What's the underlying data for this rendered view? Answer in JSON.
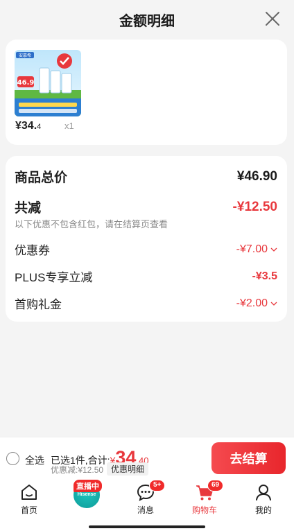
{
  "header": {
    "title": "金额明细"
  },
  "product": {
    "image_labels": {
      "badge": "安慕希",
      "price": "46.9"
    },
    "price_int": "¥34.",
    "price_dec": "4",
    "qty": "x1"
  },
  "details": {
    "total_label": "商品总价",
    "total_value": "¥46.90",
    "reduce_label": "共减",
    "reduce_value": "-¥12.50",
    "reduce_note": "以下优惠不包含红包，请在结算页查看",
    "items": [
      {
        "label": "优惠券",
        "value": "-¥7.00",
        "expandable": true
      },
      {
        "label": "PLUS专享立减",
        "value": "-¥3.5",
        "expandable": false
      },
      {
        "label": "首购礼金",
        "value": "-¥2.00",
        "expandable": true
      }
    ]
  },
  "checkout": {
    "select_all": "全选",
    "summary_prefix": "已选1件,合计:",
    "currency": "¥",
    "total_int": "34",
    "total_dec": ".40",
    "discount": "优惠减:¥12.50",
    "detail_link": "优惠明细",
    "pay_button": "去结算"
  },
  "tabbar": {
    "tabs": [
      {
        "label": "首页",
        "icon": "home-icon"
      },
      {
        "label": "",
        "icon": "live-icon",
        "badge": "直播中",
        "logo": "Hisense"
      },
      {
        "label": "消息",
        "icon": "message-icon",
        "badge": "5+"
      },
      {
        "label": "购物车",
        "icon": "cart-icon",
        "badge": "69",
        "active": true
      },
      {
        "label": "我的",
        "icon": "profile-icon"
      }
    ]
  },
  "colors": {
    "accent": "#e8383d",
    "background": "#f4f4f4",
    "card": "#ffffff"
  }
}
